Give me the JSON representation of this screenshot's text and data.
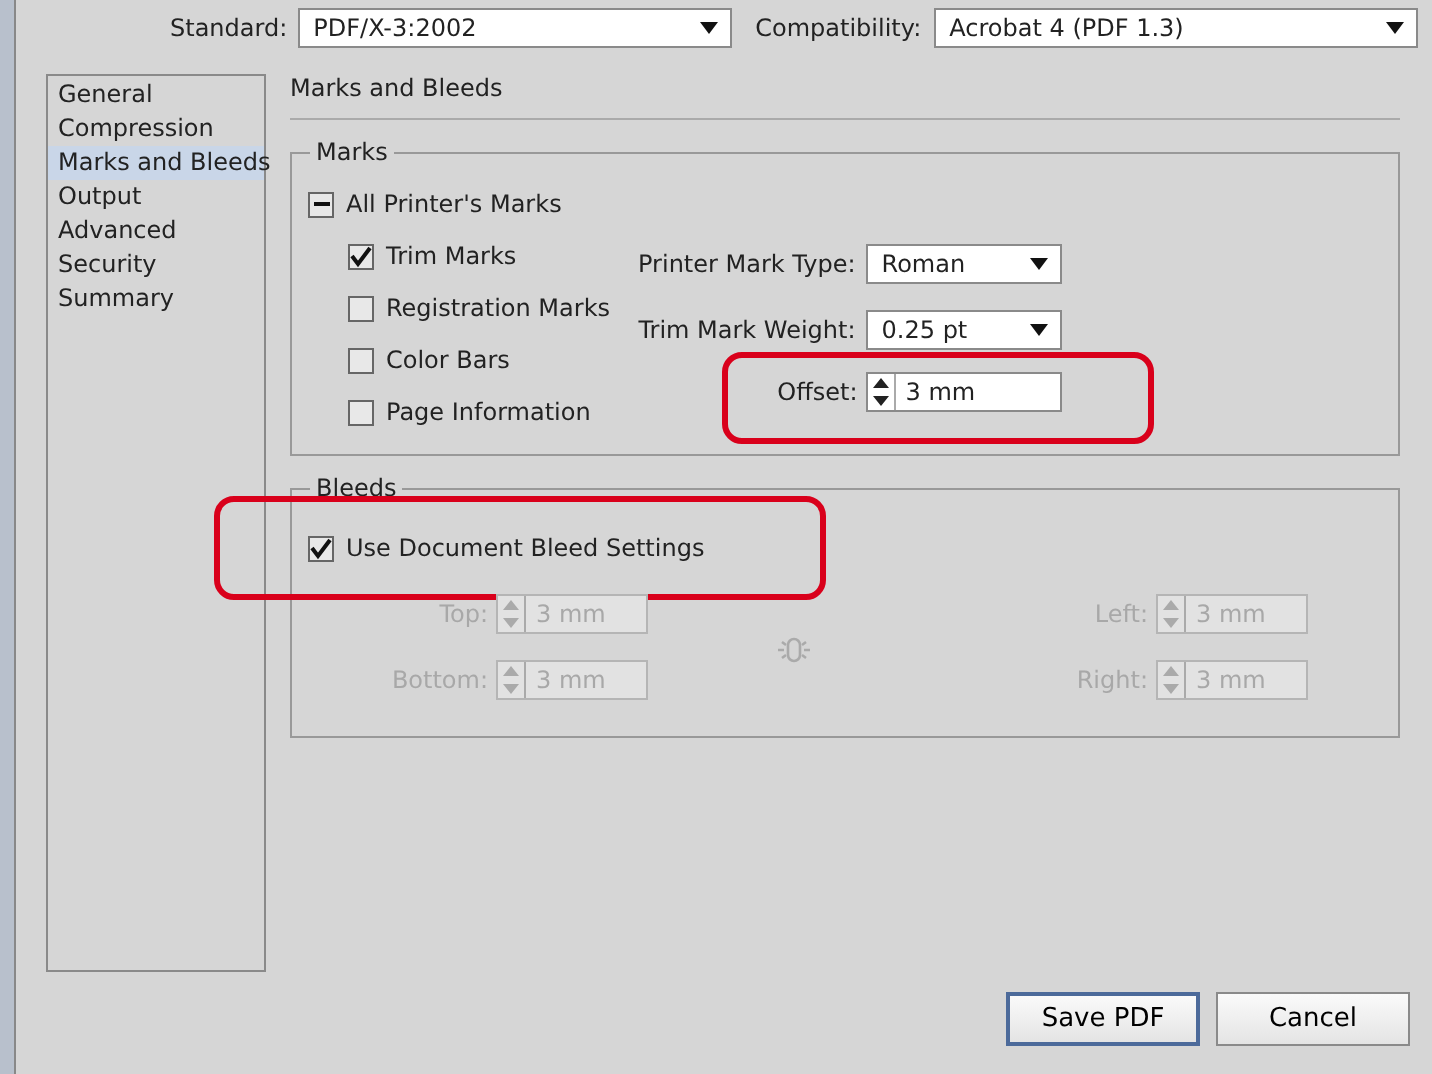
{
  "top_fields": [
    {
      "label": "Standard:",
      "value": "PDF/X-3:2002"
    },
    {
      "label": "Compatibility:",
      "value": "Acrobat 4 (PDF 1.3)"
    }
  ],
  "sidebar": {
    "items": [
      {
        "label": "General",
        "selected": false
      },
      {
        "label": "Compression",
        "selected": false
      },
      {
        "label": "Marks and Bleeds",
        "selected": true
      },
      {
        "label": "Output",
        "selected": false
      },
      {
        "label": "Advanced",
        "selected": false
      },
      {
        "label": "Security",
        "selected": false
      },
      {
        "label": "Summary",
        "selected": false
      }
    ]
  },
  "section_title": "Marks and Bleeds",
  "marks": {
    "legend": "Marks",
    "all_marks": {
      "label": "All Printer's Marks",
      "indeterminate": true
    },
    "checkboxes": [
      {
        "label": "Trim Marks",
        "checked": true
      },
      {
        "label": "Registration Marks",
        "checked": false
      },
      {
        "label": "Color Bars",
        "checked": false
      },
      {
        "label": "Page Information",
        "checked": false
      }
    ],
    "dropdowns": [
      {
        "label": "Printer Mark Type:",
        "value": "Roman"
      },
      {
        "label": "Trim Mark Weight:",
        "value": "0.25 pt"
      }
    ],
    "offset": {
      "label": "Offset:",
      "value": "3 mm",
      "highlight": true
    }
  },
  "bleeds": {
    "legend": "Bleeds",
    "use_document": {
      "label": "Use Document Bleed Settings",
      "checked": true,
      "highlight": true
    },
    "fields": [
      {
        "label": "Top:",
        "value": "3 mm",
        "disabled": true
      },
      {
        "label": "Left:",
        "value": "3 mm",
        "disabled": true
      },
      {
        "label": "Bottom:",
        "value": "3 mm",
        "disabled": true
      },
      {
        "label": "Right:",
        "value": "3 mm",
        "disabled": true
      }
    ]
  },
  "buttons": [
    {
      "label": "Save PDF",
      "default": true
    },
    {
      "label": "Cancel",
      "default": false
    }
  ]
}
